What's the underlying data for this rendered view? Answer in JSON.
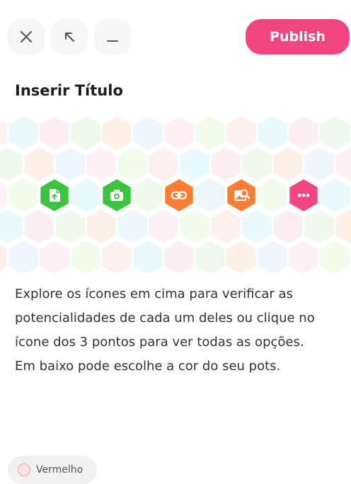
{
  "header": {
    "close_icon": "close-icon",
    "expand_icon": "arrow-up-left-icon",
    "minimize_icon": "minimize-icon",
    "publish_label": "Publish"
  },
  "title": "Inserir Título",
  "features": [
    {
      "name": "document-feature",
      "icon": "document-upload-icon",
      "color": "#3bc43f"
    },
    {
      "name": "camera-feature",
      "icon": "camera-icon",
      "color": "#3bc43f"
    },
    {
      "name": "link-feature",
      "icon": "link-icon",
      "color": "#fb7d34"
    },
    {
      "name": "image-search-feature",
      "icon": "image-search-icon",
      "color": "#fb7d34"
    },
    {
      "name": "more-feature",
      "icon": "more-dots-icon",
      "color": "#f0457f"
    }
  ],
  "description": {
    "line1": "Explore os ícones em cima para verificar as potencialidades de cada um deles ou clique no ícone dos 3 pontos para ver todas as opções.",
    "line2": "Em baixo pode escolhe a cor do seu pots."
  },
  "color_selector": {
    "label": "Vermelho",
    "color": "#fde3e3"
  },
  "palette": {
    "brand": "#f0457f",
    "green": "#3bc43f",
    "orange": "#fb7d34"
  }
}
